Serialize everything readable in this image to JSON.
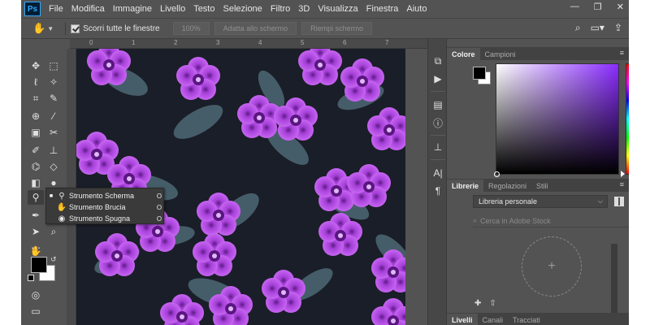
{
  "app": {
    "logo": "Ps",
    "menu": [
      "File",
      "Modifica",
      "Immagine",
      "Livello",
      "Testo",
      "Selezione",
      "Filtro",
      "3D",
      "Visualizza",
      "Finestra",
      "Aiuto"
    ],
    "window_controls": [
      "—",
      "❐",
      "✕"
    ]
  },
  "options": {
    "scroll_all_label": "Scorri tutte le finestre",
    "zoom_100": "100%",
    "fit_screen": "Adatta allo schermo",
    "fill_screen": "Riempi schermo"
  },
  "ruler": {
    "top_ticks": [
      "0",
      "1",
      "2",
      "3",
      "4",
      "5",
      "6",
      "7"
    ]
  },
  "flyout": {
    "items": [
      {
        "label": "Strumento Scherma",
        "key": "O",
        "icon": "dodge-icon",
        "selected": true
      },
      {
        "label": "Strumento Brucia",
        "key": "O",
        "icon": "burn-icon",
        "selected": false
      },
      {
        "label": "Strumento Spugna",
        "key": "O",
        "icon": "sponge-icon",
        "selected": false
      }
    ]
  },
  "panels": {
    "color_tabs": [
      "Colore",
      "Campioni"
    ],
    "library_tabs": [
      "Librerie",
      "Regolazioni",
      "Stili"
    ],
    "library_select": "Libreria personale",
    "stock_search_placeholder": "Cerca in Adobe Stock",
    "layers_tabs": [
      "Livelli",
      "Canali",
      "Tracciati"
    ],
    "add_symbol": "+"
  },
  "colors": {
    "background": "#535353",
    "canvas_bg": "#1b1f29",
    "flower": "#b44fe6",
    "flower_center": "#6a1d8f",
    "leaf": "#4f6b78"
  }
}
